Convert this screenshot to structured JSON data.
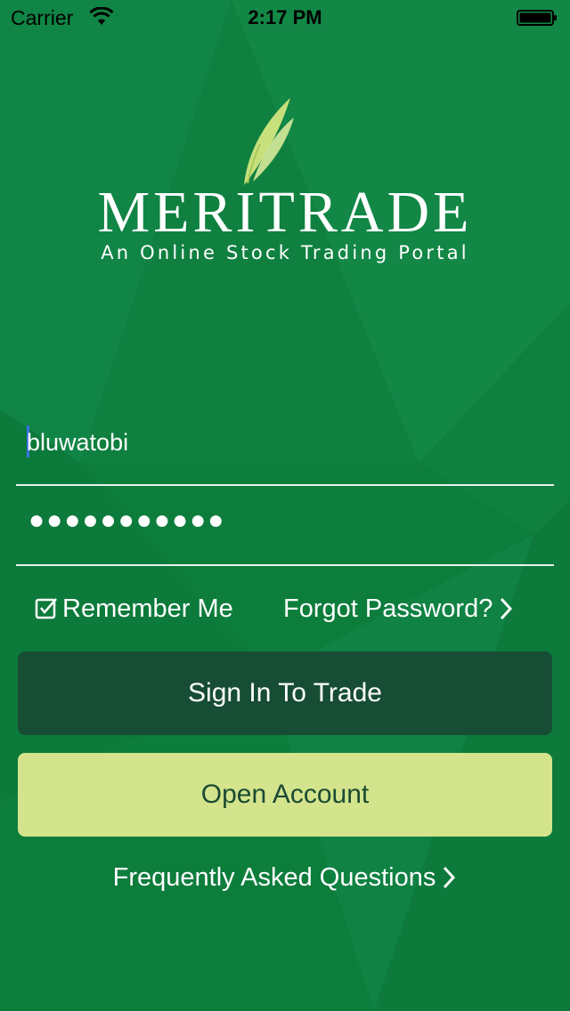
{
  "status_bar": {
    "carrier": "Carrier",
    "time": "2:17 PM",
    "icons": [
      "wifi-icon",
      "battery-icon"
    ]
  },
  "brand": {
    "name": "MERITRADE",
    "tagline": "An Online Stock Trading Portal",
    "leaf_color": "#c7e07c"
  },
  "login": {
    "username_value": "bluwatobi",
    "password_masked": "●●●●●●●●●●●",
    "remember_label": "Remember Me",
    "remember_checked": true,
    "forgot_label": "Forgot Password?"
  },
  "buttons": {
    "sign_in": "Sign In To Trade",
    "open_account": "Open Account"
  },
  "faq_label": "Frequently Asked Questions",
  "colors": {
    "background": "#0f7f3e",
    "sign_in_button": "#174d35",
    "open_account_button": "#d3e48c",
    "open_account_text": "#1b4a33",
    "caret": "#3a72e6"
  }
}
